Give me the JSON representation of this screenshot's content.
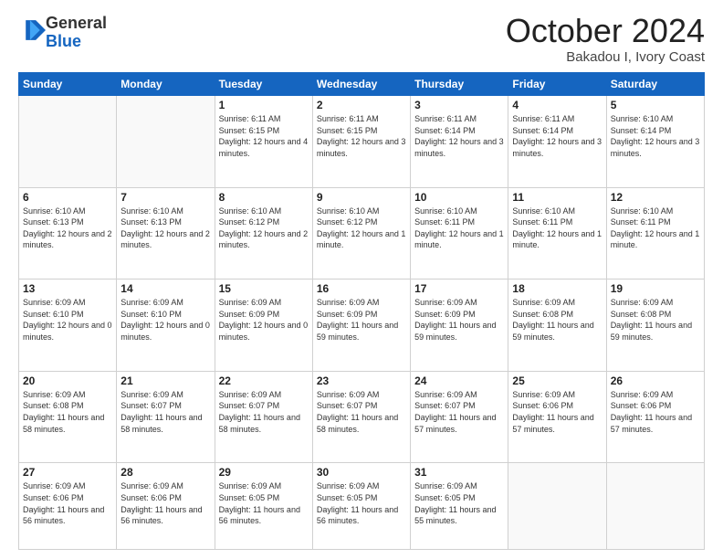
{
  "header": {
    "logo_general": "General",
    "logo_blue": "Blue",
    "month": "October 2024",
    "location": "Bakadou I, Ivory Coast"
  },
  "days_of_week": [
    "Sunday",
    "Monday",
    "Tuesday",
    "Wednesday",
    "Thursday",
    "Friday",
    "Saturday"
  ],
  "weeks": [
    [
      {
        "num": "",
        "detail": ""
      },
      {
        "num": "",
        "detail": ""
      },
      {
        "num": "1",
        "detail": "Sunrise: 6:11 AM\nSunset: 6:15 PM\nDaylight: 12 hours and 4 minutes."
      },
      {
        "num": "2",
        "detail": "Sunrise: 6:11 AM\nSunset: 6:15 PM\nDaylight: 12 hours and 3 minutes."
      },
      {
        "num": "3",
        "detail": "Sunrise: 6:11 AM\nSunset: 6:14 PM\nDaylight: 12 hours and 3 minutes."
      },
      {
        "num": "4",
        "detail": "Sunrise: 6:11 AM\nSunset: 6:14 PM\nDaylight: 12 hours and 3 minutes."
      },
      {
        "num": "5",
        "detail": "Sunrise: 6:10 AM\nSunset: 6:14 PM\nDaylight: 12 hours and 3 minutes."
      }
    ],
    [
      {
        "num": "6",
        "detail": "Sunrise: 6:10 AM\nSunset: 6:13 PM\nDaylight: 12 hours and 2 minutes."
      },
      {
        "num": "7",
        "detail": "Sunrise: 6:10 AM\nSunset: 6:13 PM\nDaylight: 12 hours and 2 minutes."
      },
      {
        "num": "8",
        "detail": "Sunrise: 6:10 AM\nSunset: 6:12 PM\nDaylight: 12 hours and 2 minutes."
      },
      {
        "num": "9",
        "detail": "Sunrise: 6:10 AM\nSunset: 6:12 PM\nDaylight: 12 hours and 1 minute."
      },
      {
        "num": "10",
        "detail": "Sunrise: 6:10 AM\nSunset: 6:11 PM\nDaylight: 12 hours and 1 minute."
      },
      {
        "num": "11",
        "detail": "Sunrise: 6:10 AM\nSunset: 6:11 PM\nDaylight: 12 hours and 1 minute."
      },
      {
        "num": "12",
        "detail": "Sunrise: 6:10 AM\nSunset: 6:11 PM\nDaylight: 12 hours and 1 minute."
      }
    ],
    [
      {
        "num": "13",
        "detail": "Sunrise: 6:09 AM\nSunset: 6:10 PM\nDaylight: 12 hours and 0 minutes."
      },
      {
        "num": "14",
        "detail": "Sunrise: 6:09 AM\nSunset: 6:10 PM\nDaylight: 12 hours and 0 minutes."
      },
      {
        "num": "15",
        "detail": "Sunrise: 6:09 AM\nSunset: 6:09 PM\nDaylight: 12 hours and 0 minutes."
      },
      {
        "num": "16",
        "detail": "Sunrise: 6:09 AM\nSunset: 6:09 PM\nDaylight: 11 hours and 59 minutes."
      },
      {
        "num": "17",
        "detail": "Sunrise: 6:09 AM\nSunset: 6:09 PM\nDaylight: 11 hours and 59 minutes."
      },
      {
        "num": "18",
        "detail": "Sunrise: 6:09 AM\nSunset: 6:08 PM\nDaylight: 11 hours and 59 minutes."
      },
      {
        "num": "19",
        "detail": "Sunrise: 6:09 AM\nSunset: 6:08 PM\nDaylight: 11 hours and 59 minutes."
      }
    ],
    [
      {
        "num": "20",
        "detail": "Sunrise: 6:09 AM\nSunset: 6:08 PM\nDaylight: 11 hours and 58 minutes."
      },
      {
        "num": "21",
        "detail": "Sunrise: 6:09 AM\nSunset: 6:07 PM\nDaylight: 11 hours and 58 minutes."
      },
      {
        "num": "22",
        "detail": "Sunrise: 6:09 AM\nSunset: 6:07 PM\nDaylight: 11 hours and 58 minutes."
      },
      {
        "num": "23",
        "detail": "Sunrise: 6:09 AM\nSunset: 6:07 PM\nDaylight: 11 hours and 58 minutes."
      },
      {
        "num": "24",
        "detail": "Sunrise: 6:09 AM\nSunset: 6:07 PM\nDaylight: 11 hours and 57 minutes."
      },
      {
        "num": "25",
        "detail": "Sunrise: 6:09 AM\nSunset: 6:06 PM\nDaylight: 11 hours and 57 minutes."
      },
      {
        "num": "26",
        "detail": "Sunrise: 6:09 AM\nSunset: 6:06 PM\nDaylight: 11 hours and 57 minutes."
      }
    ],
    [
      {
        "num": "27",
        "detail": "Sunrise: 6:09 AM\nSunset: 6:06 PM\nDaylight: 11 hours and 56 minutes."
      },
      {
        "num": "28",
        "detail": "Sunrise: 6:09 AM\nSunset: 6:06 PM\nDaylight: 11 hours and 56 minutes."
      },
      {
        "num": "29",
        "detail": "Sunrise: 6:09 AM\nSunset: 6:05 PM\nDaylight: 11 hours and 56 minutes."
      },
      {
        "num": "30",
        "detail": "Sunrise: 6:09 AM\nSunset: 6:05 PM\nDaylight: 11 hours and 56 minutes."
      },
      {
        "num": "31",
        "detail": "Sunrise: 6:09 AM\nSunset: 6:05 PM\nDaylight: 11 hours and 55 minutes."
      },
      {
        "num": "",
        "detail": ""
      },
      {
        "num": "",
        "detail": ""
      }
    ]
  ]
}
